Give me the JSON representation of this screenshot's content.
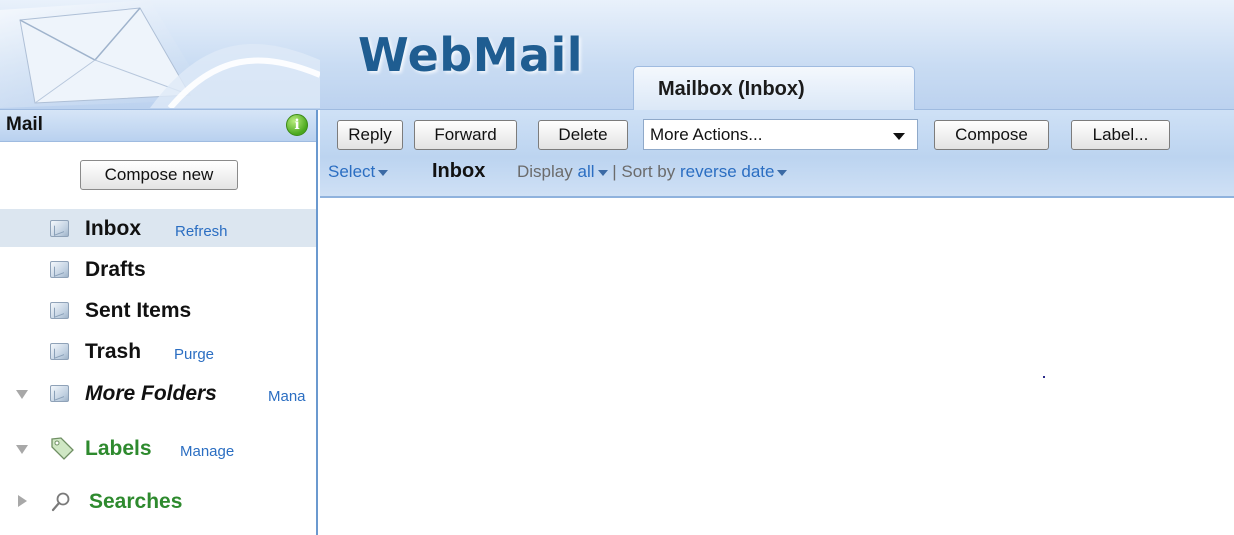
{
  "header": {
    "app_title": "WebMail",
    "tab_label": "Mailbox (Inbox)"
  },
  "sidebar": {
    "title": "Mail",
    "info_icon": "info-icon",
    "info_glyph": "i",
    "compose_new_label": "Compose new",
    "folders": [
      {
        "label": "Inbox",
        "action": "Refresh",
        "selected": true
      },
      {
        "label": "Drafts"
      },
      {
        "label": "Sent Items"
      },
      {
        "label": "Trash",
        "action": "Purge"
      },
      {
        "label": "More Folders",
        "action": "Mana",
        "expanded": true
      },
      {
        "label": "Labels",
        "action": "Manage",
        "expanded": true
      },
      {
        "label": "Searches",
        "expanded": false
      }
    ]
  },
  "toolbar": {
    "reply_label": "Reply",
    "forward_label": "Forward",
    "delete_label": "Delete",
    "more_actions_value": "More Actions...",
    "compose_label": "Compose",
    "label_label": "Label...",
    "select_label": "Select",
    "mailbox_heading": "Inbox",
    "display_prefix": "Display",
    "display_value": "all",
    "separator": "|",
    "sort_prefix": "Sort by",
    "sort_value": "reverse date"
  },
  "colors": {
    "brand": "#1f5d91",
    "link": "#2b6ec2",
    "header_bg": "#c9dcf3",
    "selected_row": "#dce6f0",
    "labels_green": "#2e8a2e"
  }
}
